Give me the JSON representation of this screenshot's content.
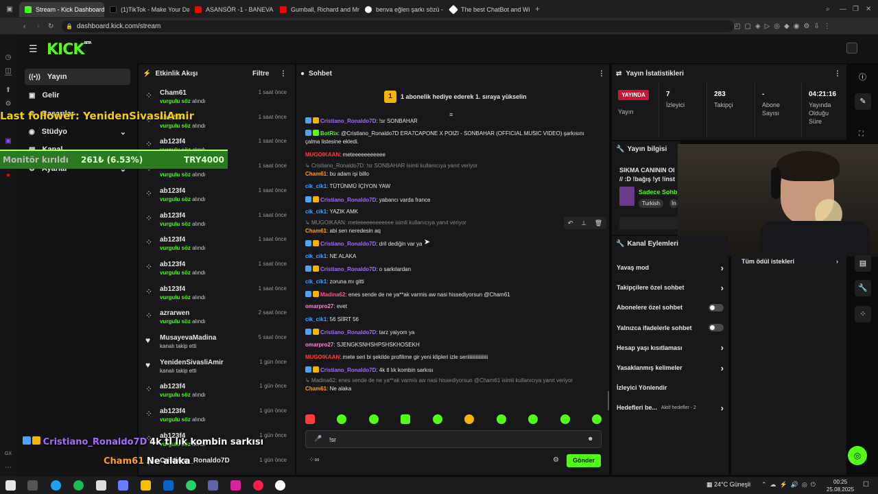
{
  "browser": {
    "tabs": [
      {
        "label": "Stream - Kick Dashboard",
        "color": "#53fc18"
      },
      {
        "label": "(1)TikTok - Make Your Da",
        "color": "#000000"
      },
      {
        "label": "ASANSÖR -1 - BANEVA -",
        "color": "#ff0000"
      },
      {
        "label": "Gumball, Richard and Mr",
        "color": "#ff0000"
      },
      {
        "label": "benva eğlen şarkı sözü -",
        "color": "#ffffff"
      },
      {
        "label": "The best ChatBot and Wi",
        "color": "#ffffff"
      }
    ],
    "url": "dashboard.kick.com/stream"
  },
  "header": {
    "logo": "KICK",
    "beta": "BETA"
  },
  "sidebar": {
    "items": [
      {
        "label": "Yayın",
        "icon": "broadcast-icon",
        "active": true
      },
      {
        "label": "Gelir",
        "icon": "revenue-icon"
      },
      {
        "label": "Başarılar",
        "icon": "trophy-icon"
      },
      {
        "label": "Stüdyo",
        "icon": "studio-icon"
      },
      {
        "label": "Kanal",
        "icon": "channel-icon"
      },
      {
        "label": "Ayarlar",
        "icon": "settings-icon"
      }
    ]
  },
  "activity": {
    "title": "Etkinlik Akışı",
    "filter": "Filtre",
    "items": [
      {
        "name": "Cham61",
        "action_strong": "vurgulu söz",
        "action": "alındı",
        "time": "1 saat önce",
        "kind": "highlight"
      },
      {
        "name": "ab123f4",
        "action_strong": "vurgulu söz",
        "action": "alındı",
        "time": "1 saat önce",
        "kind": "highlight"
      },
      {
        "name": "ab123f4",
        "action_strong": "vurgulu söz",
        "action": "alındı",
        "time": "1 saat önce",
        "kind": "highlight"
      },
      {
        "name": "ab123f4",
        "action_strong": "vurgulu söz",
        "action": "alındı",
        "time": "1 saat önce",
        "kind": "highlight"
      },
      {
        "name": "ab123f4",
        "action_strong": "vurgulu söz",
        "action": "alındı",
        "time": "1 saat önce",
        "kind": "highlight"
      },
      {
        "name": "ab123f4",
        "action_strong": "vurgulu söz",
        "action": "alındı",
        "time": "1 saat önce",
        "kind": "highlight"
      },
      {
        "name": "ab123f4",
        "action_strong": "vurgulu söz",
        "action": "alındı",
        "time": "1 saat önce",
        "kind": "highlight"
      },
      {
        "name": "ab123f4",
        "action_strong": "vurgulu söz",
        "action": "alındı",
        "time": "1 saat önce",
        "kind": "highlight"
      },
      {
        "name": "ab123f4",
        "action_strong": "vurgulu söz",
        "action": "alındı",
        "time": "1 saat önce",
        "kind": "highlight"
      },
      {
        "name": "azrarwen",
        "action_strong": "vurgulu söz",
        "action": "alındı",
        "time": "2 saat önce",
        "kind": "highlight"
      },
      {
        "name": "MusayevaMadina",
        "action_strong": "",
        "action": "kanalı takip etti",
        "time": "5 saat önce",
        "kind": "follow"
      },
      {
        "name": "YenidenSivasliAmir",
        "action_strong": "",
        "action": "kanalı takip etti",
        "time": "1 gün önce",
        "kind": "follow"
      },
      {
        "name": "ab123f4",
        "action_strong": "vurgulu söz",
        "action": "alındı",
        "time": "1 gün önce",
        "kind": "highlight"
      },
      {
        "name": "ab123f4",
        "action_strong": "vurgulu söz",
        "action": "alındı",
        "time": "1 gün önce",
        "kind": "highlight"
      },
      {
        "name": "ab123f4",
        "action_strong": "vurgulu söz",
        "action": "alındı",
        "time": "1 gün önce",
        "kind": "highlight"
      },
      {
        "name": "Cristiano_Ronaldo7D",
        "action_strong": "",
        "action": "",
        "time": "1 gün önce",
        "kind": "highlight"
      }
    ]
  },
  "chat": {
    "title": "Sohbet",
    "banner": "1 abonelik hediye ederek 1. sıraya yükselin",
    "lines": [
      {
        "user": "Cristiano_Ronaldo7D",
        "color": "#a56bff",
        "text": "!sr SONBAHAR",
        "badges": true
      },
      {
        "user": "BotRix",
        "color": "#53fc18",
        "text": "@Cristiano_Ronaldo7D ERA7CAPONE X POIZI - SONBAHAR (OFFICIAL MUSIC VIDEO) şarkısını",
        "badges": true
      },
      {
        "user": "",
        "color": "#e6e6e6",
        "text": "çalma listesine ekledi.",
        "badges": false
      },
      {
        "user": "MUGOIKAAN",
        "color": "#ff3b3b",
        "text": "meteeeeeeeeeee",
        "badges": false
      },
      {
        "reply": "Cristiano_Ronaldo7D: !sr SONBAHAR isimli kullanıcıya yanıt veriyor"
      },
      {
        "user": "Cham61",
        "color": "#ff9f1c",
        "text": "bu adam işi billo",
        "badges": false
      },
      {
        "user": "cik_cik1",
        "color": "#4aa3ff",
        "text": "TÜTÜNMÜ İÇİYON YAW",
        "badges": false
      },
      {
        "user": "Cristiano_Ronaldo7D",
        "color": "#a56bff",
        "text": "yabancı varda france",
        "badges": true
      },
      {
        "user": "cik_cik1",
        "color": "#4aa3ff",
        "text": "YAZIK AMK",
        "badges": false
      },
      {
        "reply": "MUGOIKAAN: meteeeeeeeeeeee isimli kullanıcıya yanıt veriyor"
      },
      {
        "user": "Cham61",
        "color": "#ff9f1c",
        "text": "abi sen neredesin aq",
        "badges": false
      },
      {
        "user": "Cristiano_Ronaldo7D",
        "color": "#a56bff",
        "text": "dril dediğin var ya",
        "badges": true
      },
      {
        "user": "cik_cik1",
        "color": "#4aa3ff",
        "text": "NE ALAKA",
        "badges": false
      },
      {
        "user": "Cristiano_Ronaldo7D",
        "color": "#a56bff",
        "text": "o sarkılardan",
        "badges": true
      },
      {
        "user": "cik_cik1",
        "color": "#4aa3ff",
        "text": "zoruna mı gitti",
        "badges": false
      },
      {
        "user": "Madina62",
        "color": "#ff5b8a",
        "text": "enes sende de ne ya**ak varmis aw nasi hissediyorsun @Cham61",
        "badges": true
      },
      {
        "user": "omarpro27",
        "color": "#ff8ad8",
        "text": "evet",
        "badges": false
      },
      {
        "user": "cik_cik1",
        "color": "#4aa3ff",
        "text": "56 SİİRT 56",
        "badges": false
      },
      {
        "user": "Cristiano_Ronaldo7D",
        "color": "#a56bff",
        "text": "tarz yaiyom ya",
        "badges": true
      },
      {
        "user": "omarpro27",
        "color": "#ff8ad8",
        "text": "SJENGKSNHSHPSHSKHOSEKH",
        "badges": false
      },
      {
        "user": "MUGOIKAAN",
        "color": "#ff3b3b",
        "text": "mete seri bi şekilde profilime gir yeni klipleri izle seriiiiiiiiiiiiiiiii",
        "badges": false
      },
      {
        "user": "Cristiano_Ronaldo7D",
        "color": "#a56bff",
        "text": "4k tl lık kombin sarkısı",
        "badges": true
      },
      {
        "reply": "Madina62: enes sende de ne ya**ak varmis aw nasi hissediyorsun @Cham61 isimli kullanıcıya yanıt veriyor"
      },
      {
        "user": "Cham61",
        "color": "#ff9f1c",
        "text": "Ne alaka",
        "badges": false
      }
    ],
    "input_value": "!sr",
    "send_label": "Gönder"
  },
  "stats": {
    "title": "Yayın İstatistikleri",
    "live_badge": "YAYINDA",
    "live_label": "Yayın",
    "viewers": "7",
    "viewers_label": "İzleyici",
    "followers": "283",
    "followers_label": "Takipçi",
    "subs": "-",
    "subs_label": "Abone Sayısı",
    "uptime": "04:21:16",
    "uptime_label": "Yayında Olduğu Süre"
  },
  "stream_info": {
    "title": "Yayın bilgisi",
    "stream_title": "SIKMA CANININ Ol",
    "stream_title2": "// :D !bağış !yt !inst",
    "category": "Sadece Sohb",
    "tags": [
      "Turkish",
      "İn"
    ]
  },
  "channel_actions": {
    "title": "Kanal Eylemleri",
    "items": [
      {
        "label": "Yavaş mod",
        "control": "chevron"
      },
      {
        "label": "Takipçilere özel sohbet",
        "control": "chevron"
      },
      {
        "label": "Abonelere özel sohbet",
        "control": "toggle"
      },
      {
        "label": "Yalnızca ifadelerle sohbet",
        "control": "toggle"
      },
      {
        "label": "Hesap yaşı kısıtlaması",
        "control": "chevron"
      },
      {
        "label": "Yasaklanmış kelimeler",
        "control": "chevron"
      },
      {
        "label": "İzleyici Yönlendir",
        "control": "none"
      },
      {
        "label": "Hedefleri be...",
        "control": "chevron",
        "extra": "Aktif hedefler - 2"
      }
    ],
    "rewards": "Tüm ödül istekleri"
  },
  "overlays": {
    "last_follower": "Last follower: YenidenSivasliAmir",
    "monitor_label": "Monitör kırıldı",
    "monitor_value": "261₺ (6.53%)",
    "monitor_goal": "TRY4000",
    "monitor_progress": 0.0653,
    "chat_user1": "Cristiano_Ronaldo7D",
    "chat_text1": "4k tl lık kombin sarkısı",
    "chat_user2": "Cham61",
    "chat_text2": "Ne alaka"
  },
  "taskbar": {
    "weather": "24°C Güneşli",
    "time": "00:25",
    "date": "25.08.2025"
  }
}
